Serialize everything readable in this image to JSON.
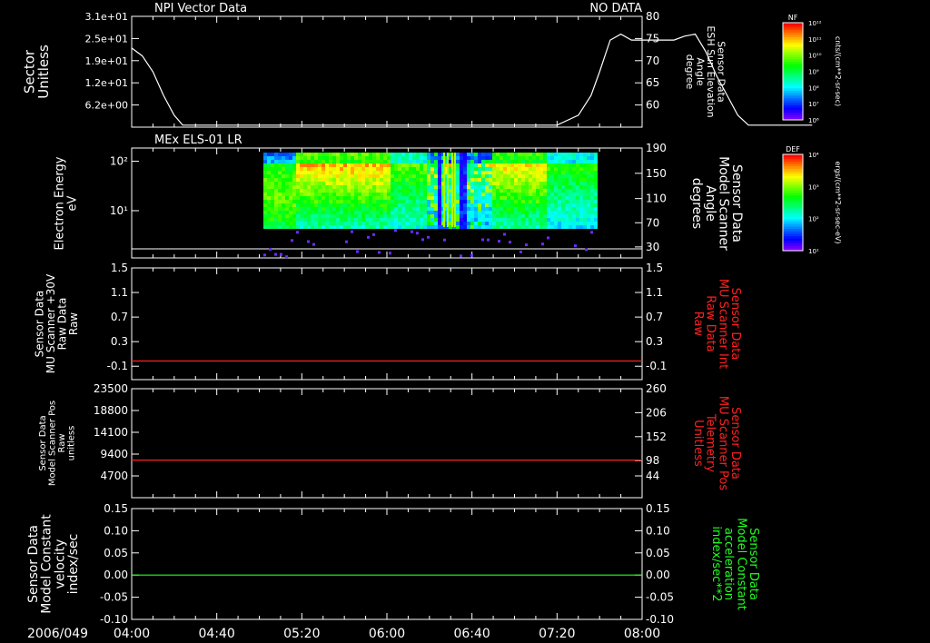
{
  "chart_data": [
    {
      "type": "line",
      "title": "NPI Vector Data",
      "status": "NO DATA",
      "ylabel": [
        "Sector",
        "Unitless"
      ],
      "yticks": [
        "3.1e+01",
        "2.5e+01",
        "1.9e+01",
        "1.2e+01",
        "6.2e+00"
      ],
      "y2label": [
        "Sensor Data",
        "ESH Sun Elevation",
        "Angle",
        "degree"
      ],
      "y2ticks": [
        "80",
        "75",
        "70",
        "65",
        "60"
      ],
      "y2lim": [
        52,
        80
      ],
      "series": [
        {
          "color": "#ffffff",
          "points": [
            [
              0,
              72
            ],
            [
              5,
              70
            ],
            [
              10,
              66
            ],
            [
              15,
              60
            ],
            [
              20,
              55
            ],
            [
              24,
              52.5
            ],
            [
              30,
              52.5
            ],
            [
              180,
              52.5
            ],
            [
              200,
              52.5
            ],
            [
              210,
              55
            ],
            [
              216,
              60
            ],
            [
              220,
              66
            ],
            [
              225,
              74
            ],
            [
              230,
              75.5
            ],
            [
              235,
              74
            ],
            [
              240,
              74
            ],
            [
              245,
              74
            ],
            [
              250,
              74
            ],
            [
              255,
              74
            ],
            [
              260,
              75
            ],
            [
              265,
              75.5
            ],
            [
              270,
              71
            ],
            [
              275,
              65
            ],
            [
              280,
              60
            ],
            [
              285,
              55
            ],
            [
              290,
              52.5
            ],
            [
              300,
              52.5
            ],
            [
              320,
              52.5
            ]
          ]
        }
      ]
    },
    {
      "type": "heatmap",
      "title": "MEx ELS-01 LR",
      "ylabel": [
        "Electron Energy",
        "eV"
      ],
      "yticks": [
        "10²",
        "10¹"
      ],
      "y2label": [
        "Sensor Data",
        "Model Scanner",
        "Angle",
        "degrees"
      ],
      "y2ticks": [
        "190",
        "150",
        "110",
        "70",
        "30"
      ],
      "colorbar": {
        "label": "DEF",
        "units": "ergs/(cm**2-sr-sec-eV)",
        "ticks": [
          "10⁴",
          "10³",
          "10²",
          "10¹"
        ]
      }
    },
    {
      "type": "line",
      "ylabel": [
        "Sensor Data",
        "MU Scanner +30V",
        "Raw Data",
        "Raw"
      ],
      "yticks": [
        "1.5",
        "1.1",
        "0.7",
        "0.3",
        "-0.1"
      ],
      "y2label": [
        "Sensor Data",
        "MU Scanner Int",
        "Raw Data",
        "Raw"
      ],
      "y2ticks": [
        "1.5",
        "1.1",
        "0.7",
        "0.3",
        "-0.1"
      ],
      "ylim": [
        -0.3,
        1.5
      ],
      "series": [
        {
          "color": "#ff2020",
          "y_constant": 0.0
        }
      ]
    },
    {
      "type": "line",
      "ylabel": [
        "Sensor Data",
        "Model Scanner Pos",
        "Raw",
        "unitless"
      ],
      "yticks": [
        "23500",
        "18800",
        "14100",
        "9400",
        "4700"
      ],
      "y2label": [
        "Sensor Data",
        "MU Scanner Pos",
        "Telemetry",
        "Unitless"
      ],
      "y2ticks": [
        "260",
        "206",
        "152",
        "98",
        "44"
      ],
      "ylim": [
        0,
        23500
      ],
      "series": [
        {
          "color": "#ff2020",
          "y_constant": 8100
        }
      ]
    },
    {
      "type": "line",
      "ylabel": [
        "Sensor Data",
        "Model Constant",
        "velocity",
        "index/sec"
      ],
      "yticks": [
        "0.15",
        "0.10",
        "0.05",
        "0.00",
        "-0.05",
        "-0.10"
      ],
      "y2label": [
        "Sensor Data",
        "Model Constant",
        "acceleration",
        "index/sec**2"
      ],
      "y2ticks": [
        "0.15",
        "0.10",
        "0.05",
        "0.00",
        "-0.05",
        "-0.10"
      ],
      "ylim": [
        -0.1,
        0.15
      ],
      "series": [
        {
          "color": "#20ff20",
          "y_constant": 0.0
        }
      ]
    }
  ],
  "colorbar_nf": {
    "label": "NF",
    "units": "cnts/(cm**2-sr-sec)",
    "ticks": [
      "10¹²",
      "10¹¹",
      "10¹⁰",
      "10⁹",
      "10⁸",
      "10⁷",
      "10⁶"
    ]
  },
  "time_axis": {
    "date": "2006/049",
    "labels": [
      "04:00",
      "04:40",
      "05:20",
      "06:00",
      "06:40",
      "07:20",
      "08:00"
    ],
    "range_minutes": [
      0,
      240
    ]
  },
  "colors": {
    "background": "#000000",
    "axis": "#ffffff",
    "red_series": "#ff2020",
    "green_series": "#20ff20"
  }
}
